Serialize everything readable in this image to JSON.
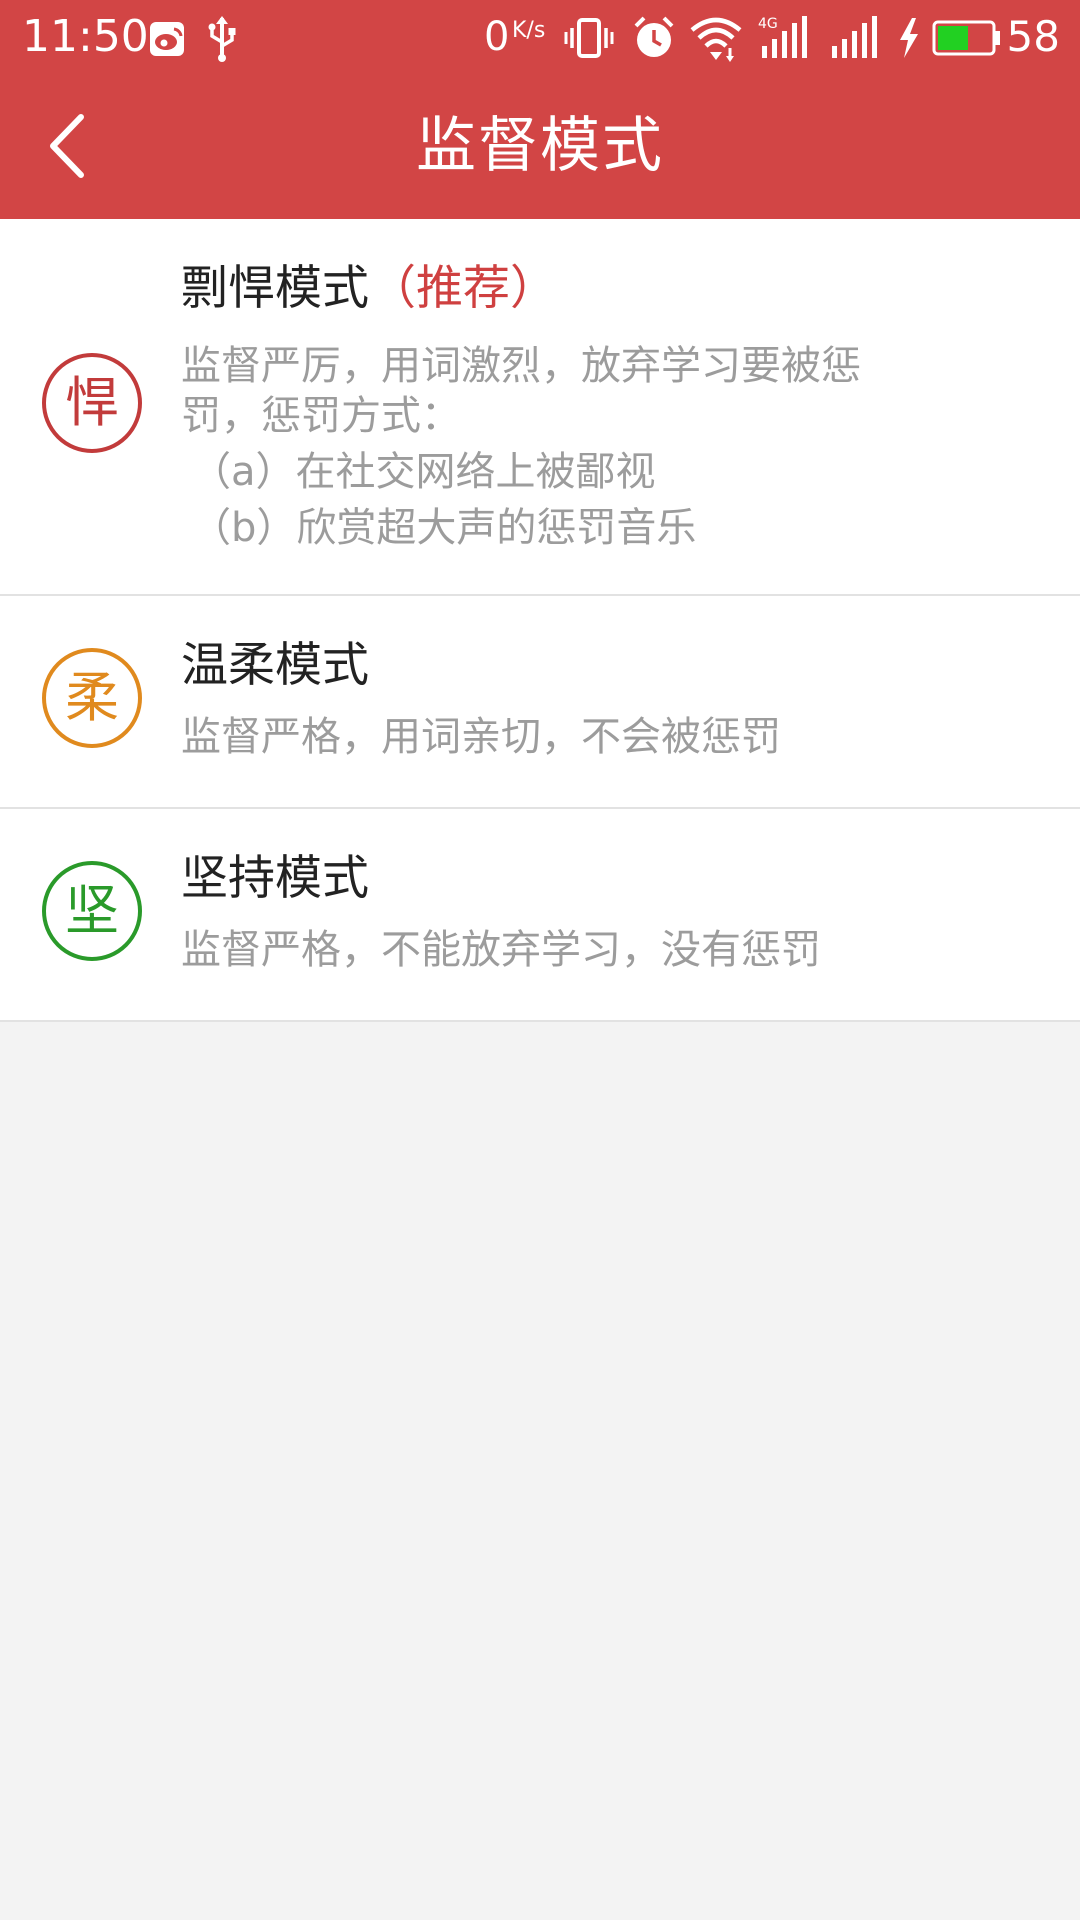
{
  "statusbar": {
    "time": "11:50",
    "net_speed_value": "0",
    "net_speed_unit": "K/s",
    "battery_percent": "58",
    "icons": [
      "weibo-icon",
      "usb-icon",
      "vibrate-icon",
      "alarm-icon",
      "wifi-icon",
      "signal-4g-icon",
      "signal-icon",
      "charging-icon",
      "battery-icon"
    ],
    "battery_level": 0.58
  },
  "toolbar": {
    "title": "监督模式",
    "back_icon": "chevron-left-icon"
  },
  "modes": [
    {
      "badge_char": "悍",
      "badge_color": "#c23b3b",
      "title": "剽悍模式",
      "recommend": "（推荐）",
      "desc_lines": [
        "监督严厉，用词激烈，放弃学习要被惩",
        "罚，惩罚方式："
      ],
      "sub_lines": [
        "（a）在社交网络上被鄙视",
        "（b）欣赏超大声的惩罚音乐"
      ]
    },
    {
      "badge_char": "柔",
      "badge_color": "#e08a1e",
      "title": "温柔模式",
      "desc_lines": [
        "监督严格，用词亲切，不会被惩罚"
      ]
    },
    {
      "badge_char": "坚",
      "badge_color": "#2a9a2a",
      "title": "坚持模式",
      "desc_lines": [
        "监督严格，不能放弃学习，没有惩罚"
      ]
    }
  ],
  "colors": {
    "primary": "#d24545",
    "background": "#f3f3f3",
    "text_primary": "#222222",
    "text_secondary": "#9c9c9c"
  }
}
